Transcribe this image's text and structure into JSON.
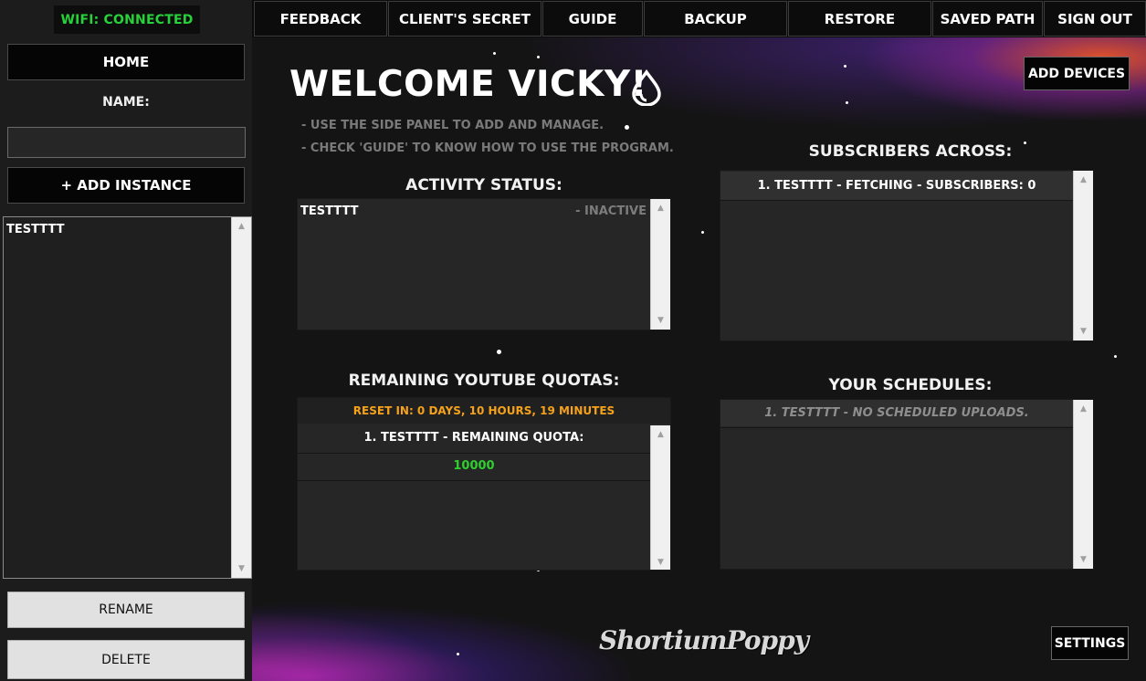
{
  "sidebar": {
    "wifi_status": "WIFI: CONNECTED",
    "home_label": "HOME",
    "name_label": "NAME:",
    "name_input_value": "",
    "add_instance_label": "+ ADD INSTANCE",
    "instances": [
      "TESTTTT"
    ],
    "rename_label": "RENAME",
    "delete_label": "DELETE"
  },
  "nav": {
    "items": [
      "FEEDBACK",
      "CLIENT'S SECRET",
      "GUIDE",
      "BACKUP",
      "RESTORE",
      "SAVED PATH",
      "SIGN OUT"
    ]
  },
  "main": {
    "welcome": "WELCOME VICKY!",
    "hints": [
      "- USE THE SIDE PANEL TO ADD AND MANAGE.",
      "- CHECK 'GUIDE' TO KNOW HOW TO USE THE PROGRAM."
    ],
    "add_devices_label": "ADD DEVICES",
    "activity": {
      "title": "ACTIVITY STATUS:",
      "items": [
        {
          "name": "TESTTTT",
          "status": "- INACTIVE"
        }
      ]
    },
    "subscribers": {
      "title": "SUBSCRIBERS ACROSS:",
      "items": [
        "1. TESTTTT - FETCHING - SUBSCRIBERS: 0"
      ]
    },
    "quotas": {
      "title": "REMAINING YOUTUBE QUOTAS:",
      "reset": "RESET IN: 0 DAYS, 10 HOURS, 19 MINUTES",
      "items": [
        {
          "label": "1. TESTTTT - REMAINING QUOTA:",
          "value": "10000"
        }
      ]
    },
    "schedules": {
      "title": "YOUR SCHEDULES:",
      "items": [
        "1. TESTTTT - NO SCHEDULED UPLOADS."
      ]
    },
    "brand": "ShortiumPoppy",
    "settings_label": "SETTINGS"
  },
  "colors": {
    "wifi_connected": "#27d13a",
    "reset_timer": "#f5a21a",
    "quota_value": "#2fcf2f",
    "panel_bg": "#262626",
    "app_bg": "#141414"
  },
  "icons": [
    "water-drop-icon",
    "scroll-up-arrow-icon",
    "scroll-down-arrow-icon"
  ]
}
